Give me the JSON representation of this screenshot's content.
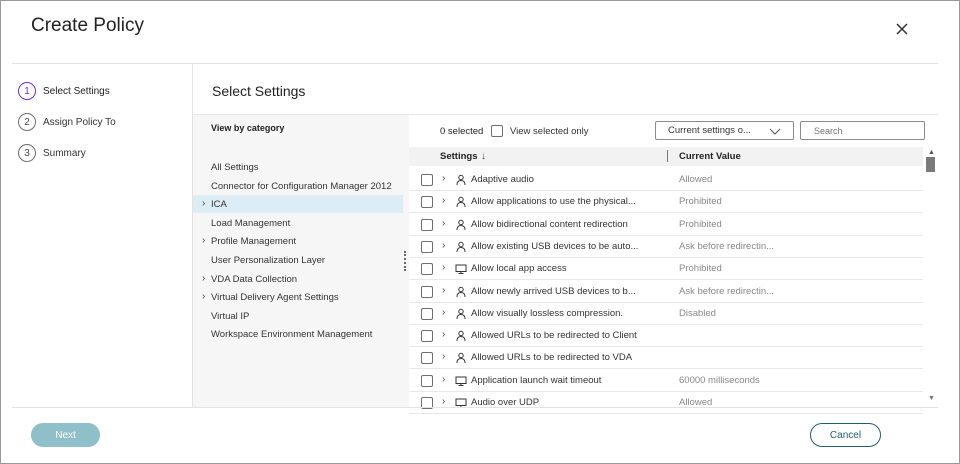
{
  "dialog": {
    "title": "Create Policy"
  },
  "steps": [
    {
      "num": "1",
      "label": "Select Settings"
    },
    {
      "num": "2",
      "label": "Assign Policy To"
    },
    {
      "num": "3",
      "label": "Summary"
    }
  ],
  "main": {
    "title": "Select Settings"
  },
  "categories": {
    "heading": "View by category",
    "items": [
      {
        "label": "All Settings",
        "expandable": false,
        "selected": false
      },
      {
        "label": "Connector for Configuration Manager 2012",
        "expandable": false,
        "selected": false
      },
      {
        "label": "ICA",
        "expandable": true,
        "selected": true
      },
      {
        "label": "Load Management",
        "expandable": false,
        "selected": false
      },
      {
        "label": "Profile Management",
        "expandable": true,
        "selected": false
      },
      {
        "label": "User Personalization Layer",
        "expandable": false,
        "selected": false
      },
      {
        "label": "VDA Data Collection",
        "expandable": true,
        "selected": false
      },
      {
        "label": "Virtual Delivery Agent Settings",
        "expandable": true,
        "selected": false
      },
      {
        "label": "Virtual IP",
        "expandable": false,
        "selected": false
      },
      {
        "label": "Workspace Environment Management",
        "expandable": false,
        "selected": false
      }
    ]
  },
  "toolbar": {
    "selected_count": "0 selected",
    "view_selected_label": "View selected only",
    "dropdown_value": "Current settings o...",
    "search_placeholder": "Search"
  },
  "table": {
    "col_settings": "Settings",
    "col_value": "Current Value",
    "rows": [
      {
        "icon": "user-icon",
        "name": "Adaptive audio",
        "value": "Allowed"
      },
      {
        "icon": "user-icon",
        "name": "Allow applications to use the physical...",
        "value": "Prohibited"
      },
      {
        "icon": "user-icon",
        "name": "Allow bidirectional content redirection",
        "value": "Prohibited"
      },
      {
        "icon": "user-icon",
        "name": "Allow existing USB devices to be auto...",
        "value": "Ask before redirectin..."
      },
      {
        "icon": "computer-icon",
        "name": "Allow local app access",
        "value": "Prohibited"
      },
      {
        "icon": "user-icon",
        "name": "Allow newly arrived USB devices to b...",
        "value": "Ask before redirectin..."
      },
      {
        "icon": "user-icon",
        "name": "Allow visually lossless compression.",
        "value": "Disabled"
      },
      {
        "icon": "user-icon",
        "name": "Allowed URLs to be redirected to Client",
        "value": ""
      },
      {
        "icon": "user-icon",
        "name": "Allowed URLs to be redirected to VDA",
        "value": ""
      },
      {
        "icon": "computer-icon",
        "name": "Application launch wait timeout",
        "value": "60000 milliseconds"
      },
      {
        "icon": "computer-icon",
        "name": "Audio over UDP",
        "value": "Allowed"
      }
    ]
  },
  "footer": {
    "next_label": "Next",
    "cancel_label": "Cancel"
  },
  "colors": {
    "accent": "#6f2fd0",
    "next_button": "#8fbfc8",
    "cancel_border": "#1f5f6a",
    "selected_row": "#dcedf5"
  }
}
